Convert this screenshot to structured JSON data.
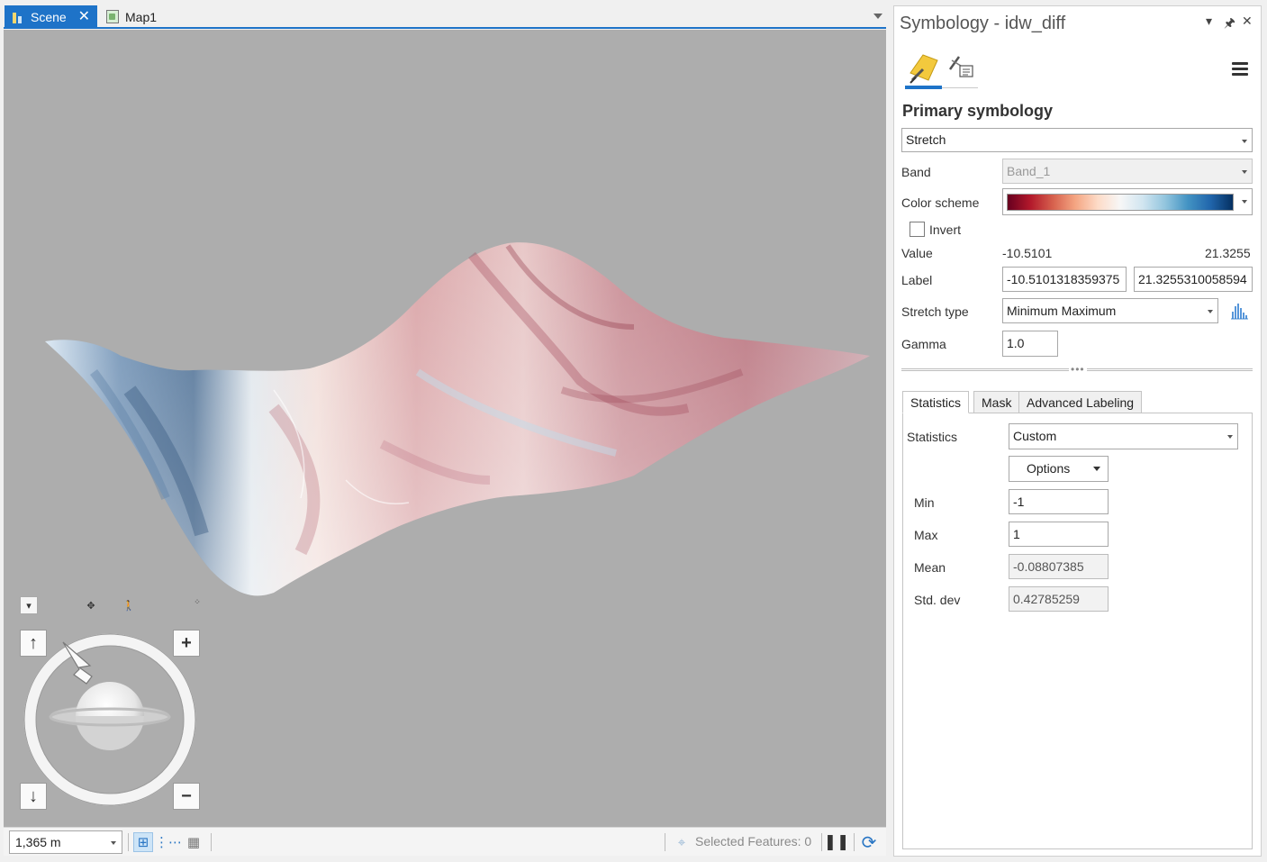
{
  "tabs": {
    "scene": {
      "label": "Scene",
      "close": "✕"
    },
    "map": {
      "label": "Map1"
    }
  },
  "navigator": {
    "collapse_icon": "chevron-down-icon",
    "full_extent_icon": "full-extent-icon",
    "walk_icon": "walk-icon",
    "up_label": "↑",
    "down_label": "↓",
    "zoom_in_label": "+",
    "zoom_out_label": "−"
  },
  "status_bar": {
    "scale": "1,365 m",
    "selected_features": "Selected Features: 0"
  },
  "symbology": {
    "title": "Symbology - idw_diff",
    "pane_controls": {
      "dropdown": "▾",
      "pin": "🖈",
      "close": "✕"
    },
    "section_title": "Primary symbology",
    "renderer": "Stretch",
    "band_label": "Band",
    "band_value": "Band_1",
    "color_scheme_label": "Color scheme",
    "color_scheme_colors": [
      "#67001f",
      "#b2182b",
      "#d6604d",
      "#f4a582",
      "#fddbc7",
      "#f7f7f7",
      "#d1e5f0",
      "#92c5de",
      "#4393c3",
      "#2166ac",
      "#053061"
    ],
    "invert_label": "Invert",
    "invert_checked": false,
    "value_label": "Value",
    "value_min": "-10.5101",
    "value_max": "21.3255",
    "label_label": "Label",
    "label_min": "-10.5101318359375",
    "label_max": "21.3255310058594",
    "stretch_type_label": "Stretch type",
    "stretch_type_value": "Minimum Maximum",
    "gamma_label": "Gamma",
    "gamma_value": "1.0",
    "subtabs": [
      "Statistics",
      "Mask",
      "Advanced Labeling"
    ],
    "statistics": {
      "statistics_label": "Statistics",
      "statistics_value": "Custom",
      "options_label": "Options",
      "min_label": "Min",
      "min_value": "-1",
      "max_label": "Max",
      "max_value": "1",
      "mean_label": "Mean",
      "mean_value": "-0.08807385",
      "std_label": "Std. dev",
      "std_value": "0.42785259"
    }
  }
}
